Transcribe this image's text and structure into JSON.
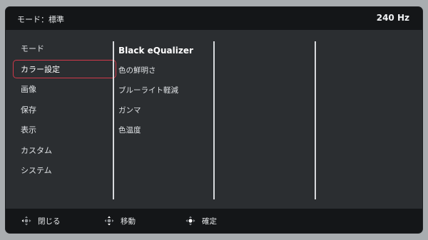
{
  "header": {
    "mode": "モード：標準",
    "refresh": "240 Hz"
  },
  "menu": {
    "items": [
      {
        "label": "モード"
      },
      {
        "label": "カラー設定"
      },
      {
        "label": "画像"
      },
      {
        "label": "保存"
      },
      {
        "label": "表示"
      },
      {
        "label": "カスタム"
      },
      {
        "label": "システム"
      }
    ],
    "selected": "カラー設定"
  },
  "submenu": {
    "items": [
      {
        "label": "Black eQualizer"
      },
      {
        "label": "色の鮮明さ"
      },
      {
        "label": "ブルーライト軽減"
      },
      {
        "label": "ガンマ"
      },
      {
        "label": "色温度"
      }
    ]
  },
  "footer": {
    "close": "閉じる",
    "move": "移動",
    "confirm": "確定"
  },
  "colors": {
    "selection_border": "#d1394a",
    "header_bg": "#141618",
    "panel_bg": "#2b2e31"
  }
}
